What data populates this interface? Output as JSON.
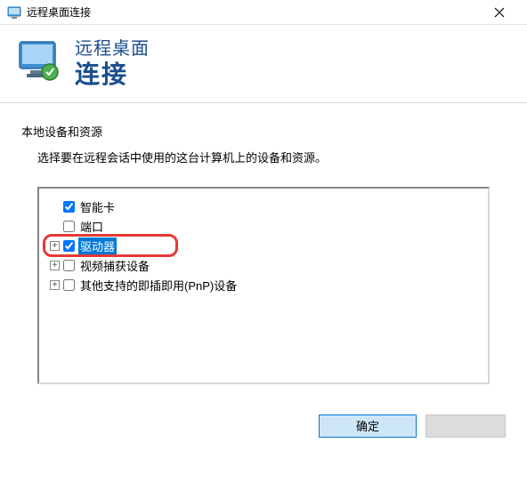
{
  "window": {
    "title": "远程桌面连接"
  },
  "header": {
    "line1": "远程桌面",
    "line2": "连接"
  },
  "section": {
    "title": "本地设备和资源",
    "description": "选择要在远程会话中使用的这台计算机上的设备和资源。"
  },
  "tree": {
    "items": [
      {
        "label": "智能卡",
        "checked": true,
        "expandable": false
      },
      {
        "label": "端口",
        "checked": false,
        "expandable": false
      },
      {
        "label": "驱动器",
        "checked": true,
        "expandable": true,
        "selected": true,
        "highlighted": true
      },
      {
        "label": "视频捕获设备",
        "checked": false,
        "expandable": true
      },
      {
        "label": "其他支持的即插即用(PnP)设备",
        "checked": false,
        "expandable": true
      }
    ]
  },
  "buttons": {
    "ok": "确定"
  }
}
